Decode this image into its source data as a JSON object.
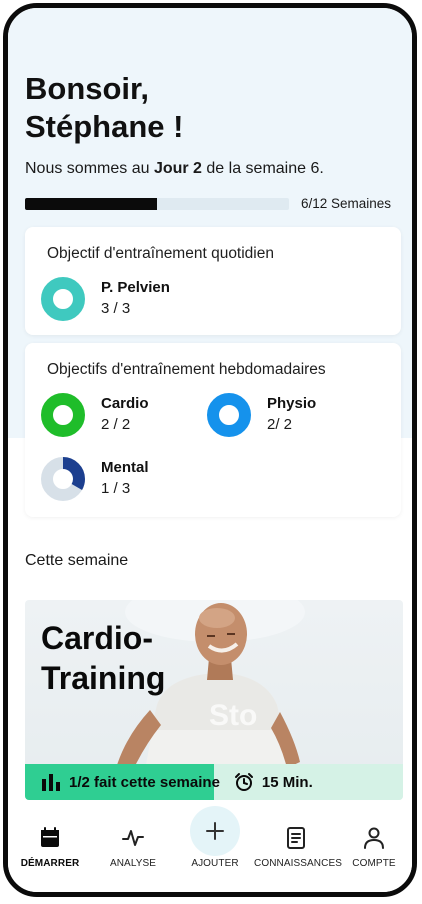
{
  "greeting": {
    "line1": "Bonsoir,",
    "line2": "Stéphane !"
  },
  "week": {
    "prefix": "Nous sommes au ",
    "day": "Jour 2",
    "suffix": " de la semaine 6.",
    "progress_label": "6/12 Semaines",
    "progress_fraction": 0.5
  },
  "daily": {
    "title": "Objectif d'entraînement quotidien",
    "goals": [
      {
        "name": "P. Pelvien",
        "count": "3 / 3",
        "fraction": 1,
        "color": "#3fc9bf"
      }
    ]
  },
  "weekly": {
    "title": "Objectifs d'entraînement hebdomadaires",
    "goals": [
      {
        "name": "Cardio",
        "count": "2 / 2",
        "fraction": 1,
        "color": "#1fbd2a"
      },
      {
        "name": "Physio",
        "count": "2/ 2",
        "fraction": 1,
        "color": "#1592ec"
      },
      {
        "name": "Mental",
        "count": "1 / 3",
        "fraction": 0.333,
        "color": "#1c3f8f",
        "track": "#d7e0e8"
      }
    ]
  },
  "this_week": {
    "title": "Cette semaine",
    "workout": {
      "title_line1": "Cardio-",
      "title_line2": "Training",
      "done_label": "1/2 fait cette semaine",
      "done_fraction": 0.5,
      "duration": "15 Min."
    }
  },
  "tabs": [
    {
      "label": "DÉMARRER",
      "icon": "calendar-icon",
      "active": true
    },
    {
      "label": "ANALYSE",
      "icon": "pulse-icon",
      "active": false
    },
    {
      "label": "AJOUTER",
      "icon": "plus-icon",
      "active": false
    },
    {
      "label": "CONNAISSANCES",
      "icon": "document-icon",
      "active": false
    },
    {
      "label": "COMPTE",
      "icon": "user-icon",
      "active": false
    }
  ]
}
